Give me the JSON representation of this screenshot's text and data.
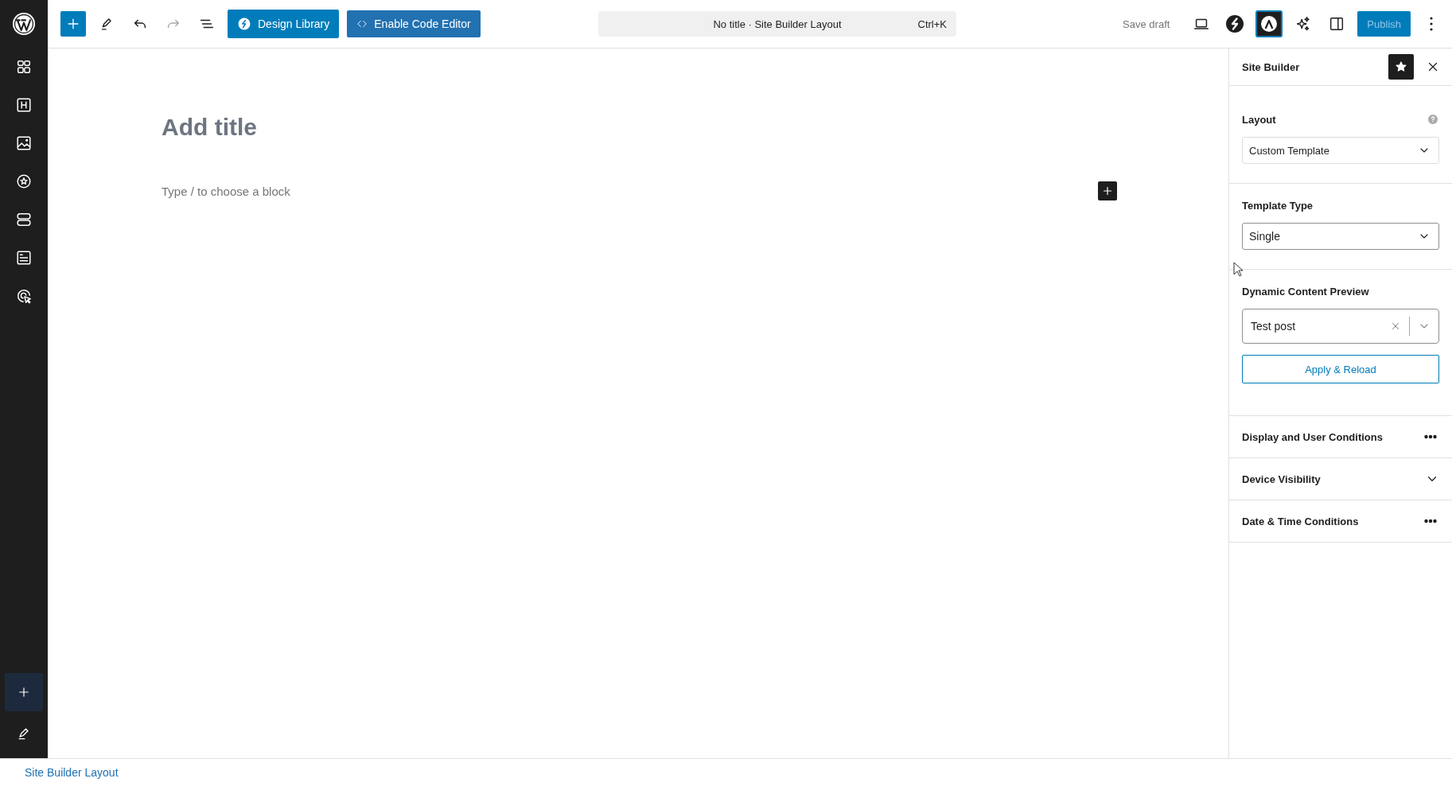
{
  "toolbar": {
    "redo": {
      "disabled": true
    },
    "buttons": [
      {
        "label": "Design Library",
        "kind": "primary"
      },
      {
        "label": "Enable Code Editor",
        "kind": "secondary"
      }
    ]
  },
  "command_bar": {
    "title": "No title · Site Builder Layout",
    "shortcut": "Ctrl+K"
  },
  "actions": {
    "save_draft": "Save draft",
    "plugin_toggle": {
      "selected": true
    },
    "publish": {
      "label": "Publish",
      "disabled": true
    }
  },
  "editor": {
    "title_placeholder": "Add title",
    "block_placeholder": "Type / to choose a block"
  },
  "panel": {
    "title": "Site Builder",
    "sections": [
      {
        "kind": "select",
        "label": "Layout",
        "value": "Custom Template",
        "help": true
      },
      {
        "kind": "select",
        "label": "Template Type",
        "value": "Single"
      },
      {
        "kind": "combobox",
        "label": "Dynamic Content Preview",
        "value": "Test post",
        "button": "Apply & Reload"
      },
      {
        "kind": "menu",
        "label": "Display and User Conditions"
      },
      {
        "kind": "expand",
        "label": "Device Visibility"
      },
      {
        "kind": "menu",
        "label": "Date & Time Conditions"
      }
    ]
  },
  "footer": {
    "breadcrumb": "Site Builder Layout"
  }
}
